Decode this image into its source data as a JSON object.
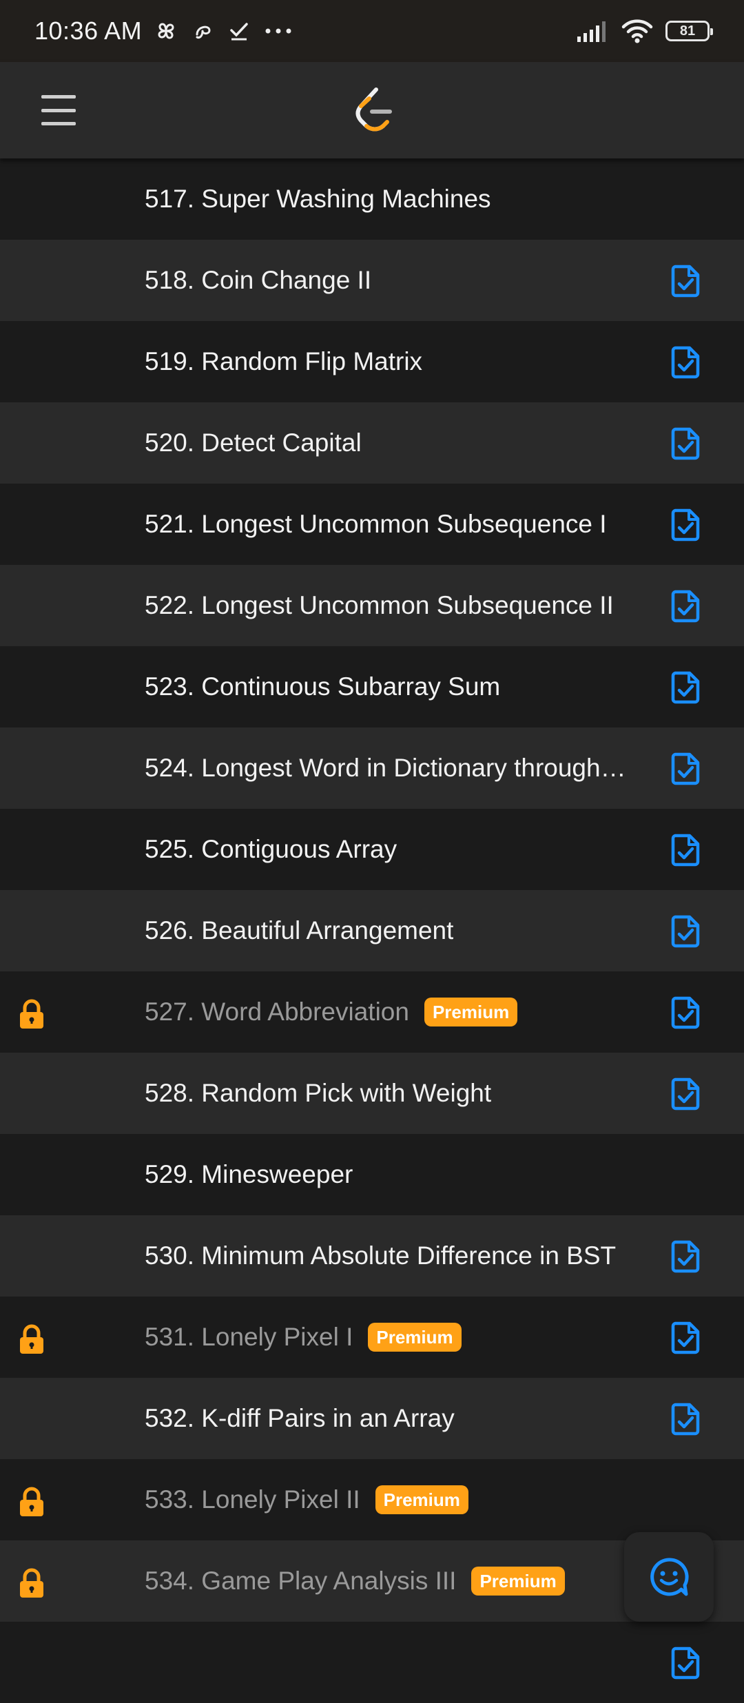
{
  "status_bar": {
    "time": "10:36 AM",
    "battery": "81",
    "left_icons": [
      "pinwheel-icon",
      "swirl-icon",
      "check-icon",
      "more-dots-icon"
    ],
    "right_icons": [
      "signal-icon",
      "wifi-icon",
      "battery-icon"
    ]
  },
  "header": {
    "menu_icon": "menu-icon",
    "logo_icon": "leetcode-logo-icon"
  },
  "colors": {
    "premium": "#ffa116",
    "solution_icon": "#1a8fff",
    "lock": "#ffa116"
  },
  "problems": [
    {
      "title": "517. Super Washing Machines",
      "locked": false,
      "premium": "",
      "solution": false
    },
    {
      "title": "518. Coin Change II",
      "locked": false,
      "premium": "",
      "solution": true
    },
    {
      "title": "519. Random Flip Matrix",
      "locked": false,
      "premium": "",
      "solution": true
    },
    {
      "title": "520. Detect Capital",
      "locked": false,
      "premium": "",
      "solution": true
    },
    {
      "title": "521. Longest Uncommon Subsequence I",
      "locked": false,
      "premium": "",
      "solution": true
    },
    {
      "title": "522. Longest Uncommon Subsequence II",
      "locked": false,
      "premium": "",
      "solution": true
    },
    {
      "title": "523. Continuous Subarray Sum",
      "locked": false,
      "premium": "",
      "solution": true
    },
    {
      "title": "524. Longest Word in Dictionary through…",
      "locked": false,
      "premium": "",
      "solution": true
    },
    {
      "title": "525. Contiguous Array",
      "locked": false,
      "premium": "",
      "solution": true
    },
    {
      "title": "526. Beautiful Arrangement",
      "locked": false,
      "premium": "",
      "solution": true
    },
    {
      "title": "527. Word Abbreviation",
      "locked": true,
      "premium": "Premium",
      "solution": true
    },
    {
      "title": "528. Random Pick with Weight",
      "locked": false,
      "premium": "",
      "solution": true
    },
    {
      "title": "529. Minesweeper",
      "locked": false,
      "premium": "",
      "solution": false
    },
    {
      "title": "530. Minimum Absolute Difference in BST",
      "locked": false,
      "premium": "",
      "solution": true
    },
    {
      "title": "531. Lonely Pixel I",
      "locked": true,
      "premium": "Premium",
      "solution": true
    },
    {
      "title": "532. K-diff Pairs in an Array",
      "locked": false,
      "premium": "",
      "solution": true
    },
    {
      "title": "533. Lonely Pixel II",
      "locked": true,
      "premium": "Premium",
      "solution": false
    },
    {
      "title": "534. Game Play Analysis III",
      "locked": true,
      "premium": "Premium",
      "solution": false
    },
    {
      "title": "",
      "locked": false,
      "premium": "",
      "solution": true
    }
  ],
  "fab": {
    "icon": "chat-smile-icon"
  }
}
